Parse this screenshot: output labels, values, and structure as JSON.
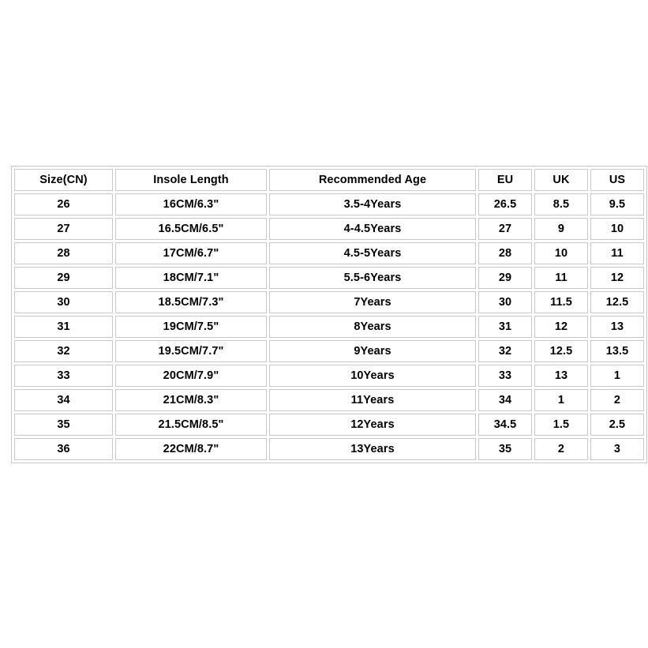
{
  "page": {
    "background_color": "#ffffff",
    "border_color": "#c8c8c8",
    "text_color": "#000000"
  },
  "chart_data": {
    "type": "table",
    "title": "",
    "columns": [
      "Size(CN)",
      "Insole Length",
      "Recommended Age",
      "EU",
      "UK",
      "US"
    ],
    "rows": [
      [
        "26",
        "16CM/6.3\"",
        "3.5-4Years",
        "26.5",
        "8.5",
        "9.5"
      ],
      [
        "27",
        "16.5CM/6.5\"",
        "4-4.5Years",
        "27",
        "9",
        "10"
      ],
      [
        "28",
        "17CM/6.7\"",
        "4.5-5Years",
        "28",
        "10",
        "11"
      ],
      [
        "29",
        "18CM/7.1\"",
        "5.5-6Years",
        "29",
        "11",
        "12"
      ],
      [
        "30",
        "18.5CM/7.3\"",
        "7Years",
        "30",
        "11.5",
        "12.5"
      ],
      [
        "31",
        "19CM/7.5\"",
        "8Years",
        "31",
        "12",
        "13"
      ],
      [
        "32",
        "19.5CM/7.7\"",
        "9Years",
        "32",
        "12.5",
        "13.5"
      ],
      [
        "33",
        "20CM/7.9\"",
        "10Years",
        "33",
        "13",
        "1"
      ],
      [
        "34",
        "21CM/8.3\"",
        "11Years",
        "34",
        "1",
        "2"
      ],
      [
        "35",
        "21.5CM/8.5\"",
        "12Years",
        "34.5",
        "1.5",
        "2.5"
      ],
      [
        "36",
        "22CM/8.7\"",
        "13Years",
        "35",
        "2",
        "3"
      ]
    ]
  }
}
